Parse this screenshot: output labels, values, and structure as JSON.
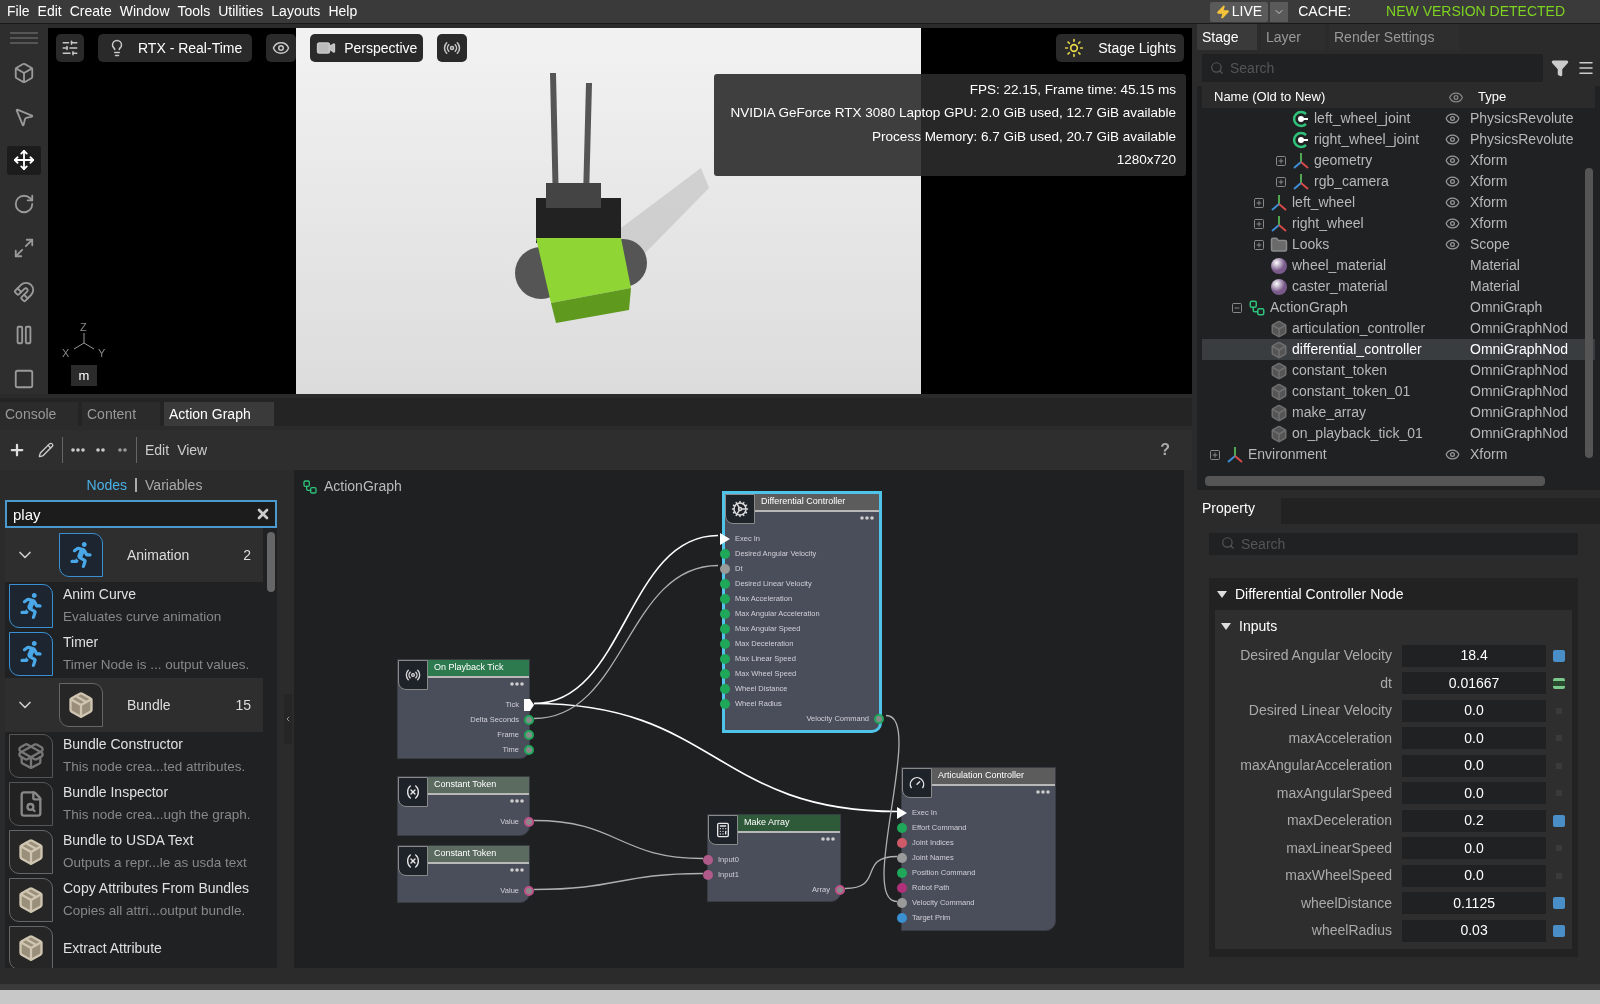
{
  "menu": [
    "File",
    "Edit",
    "Create",
    "Window",
    "Tools",
    "Utilities",
    "Layouts",
    "Help"
  ],
  "live": {
    "label": "LIVE",
    "cache_label": "CACHE:",
    "cache_status": "NEW VERSION DETECTED"
  },
  "tools": [
    {
      "kind": "select",
      "selected": false
    },
    {
      "kind": "pointer",
      "selected": false
    },
    {
      "kind": "move",
      "selected": true
    },
    {
      "kind": "rotate",
      "selected": false
    },
    {
      "kind": "scale",
      "selected": false
    },
    {
      "kind": "snap",
      "selected": false
    },
    {
      "kind": "pause",
      "selected": false
    },
    {
      "kind": "stop",
      "selected": false
    }
  ],
  "viewport": {
    "render_mode": "RTX - Real-Time",
    "camera": "Perspective",
    "lights": "Stage Lights",
    "stats": [
      "FPS: 22.15, Frame time: 45.15 ms",
      "NVIDIA GeForce RTX 3080 Laptop GPU: 2.0 GiB used, 12.7 GiB available",
      "Process Memory: 6.7 GiB used, 20.7 GiB available",
      "1280x720"
    ],
    "axes": [
      "Z",
      "X",
      "Y"
    ],
    "units": "m"
  },
  "bottom_tabs": [
    {
      "label": "Console",
      "selected": false
    },
    {
      "label": "Content",
      "selected": false
    },
    {
      "label": "Action Graph",
      "selected": true
    }
  ],
  "graph_toolbar": {
    "menus": [
      "Edit",
      "View"
    ],
    "help": "?"
  },
  "library": {
    "modes": [
      {
        "label": "Nodes",
        "selected": true
      },
      {
        "label": "Variables",
        "selected": false
      }
    ],
    "search": {
      "value": "play"
    },
    "categories": [
      {
        "name": "Animation",
        "count": "2",
        "kind": "animation",
        "expanded": true,
        "items": [
          {
            "name": "Anim Curve",
            "description": "Evaluates curve animation",
            "kind": "animation"
          },
          {
            "name": "Timer",
            "description": "Timer Node is ... output values.",
            "kind": "animation"
          }
        ]
      },
      {
        "name": "Bundle",
        "count": "15",
        "kind": "bundle",
        "expanded": true,
        "items": [
          {
            "name": "Bundle Constructor",
            "description": "This node crea...ted attributes.",
            "kind": "constructor"
          },
          {
            "name": "Bundle Inspector",
            "description": "This node crea...ugh the graph.",
            "kind": "inspector"
          },
          {
            "name": "Bundle to USDA Text",
            "description": "Outputs a repr...le as usda text",
            "kind": "bundle"
          },
          {
            "name": "Copy Attributes From Bundles",
            "description": "Copies all attri...output bundle.",
            "kind": "bundle"
          },
          {
            "name": "Extract Attribute",
            "kind": "bundle"
          }
        ]
      }
    ]
  },
  "graph": {
    "title": "ActionGraph",
    "nodes": [
      {
        "title": "Differential Controller",
        "kind": "controller",
        "color": "#5c5c5c",
        "selected": true,
        "inputs": [
          {
            "label": "Exec In",
            "kind": "exec",
            "color": "#ffffff"
          },
          {
            "label": "Desired Angular Velocity",
            "kind": "data",
            "color": "#1fa85a"
          },
          {
            "label": "Dt",
            "kind": "data",
            "color": "#9a9a9a"
          },
          {
            "label": "Desired Linear Velocity",
            "kind": "data",
            "color": "#1fa85a"
          },
          {
            "label": "Max Acceleration",
            "kind": "data",
            "color": "#1fa85a"
          },
          {
            "label": "Max Angular Acceleration",
            "kind": "data",
            "color": "#1fa85a"
          },
          {
            "label": "Max Angular Speed",
            "kind": "data",
            "color": "#1fa85a"
          },
          {
            "label": "Max Deceleration",
            "kind": "data",
            "color": "#1fa85a"
          },
          {
            "label": "Max Linear Speed",
            "kind": "data",
            "color": "#1fa85a"
          },
          {
            "label": "Max Wheel Speed",
            "kind": "data",
            "color": "#1fa85a"
          },
          {
            "label": "Wheel Distance",
            "kind": "data",
            "color": "#1fa85a"
          },
          {
            "label": "Wheel Radius",
            "kind": "data",
            "color": "#1fa85a"
          }
        ],
        "outputs": [
          {
            "label": "Velocity Command",
            "kind": "data",
            "color": "#1fa85a"
          }
        ]
      },
      {
        "title": "On Playback Tick",
        "kind": "playback",
        "color": "#2d7a4f",
        "selected": false,
        "outputs": [
          {
            "label": "Tick",
            "kind": "exec",
            "color": "#ffffff"
          },
          {
            "label": "Delta Seconds",
            "kind": "data",
            "color": "#1fa85a"
          },
          {
            "label": "Frame",
            "kind": "data",
            "color": "#1fa85a"
          },
          {
            "label": "Time",
            "kind": "data",
            "color": "#1fa85a"
          }
        ]
      },
      {
        "title": "Constant Token",
        "kind": "constant",
        "color": "#5b6b60",
        "selected": false,
        "outputs": [
          {
            "label": "Value",
            "kind": "data",
            "color": "#c0508a"
          }
        ]
      },
      {
        "title": "Constant Token",
        "kind": "constant",
        "color": "#5b6b60",
        "selected": false,
        "outputs": [
          {
            "label": "Value",
            "kind": "data",
            "color": "#c0508a"
          }
        ]
      },
      {
        "title": "Make Array",
        "kind": "math",
        "color": "#2f5a3a",
        "selected": false,
        "inputs": [
          {
            "label": "Input0",
            "kind": "data",
            "color": "#b05a8a"
          },
          {
            "label": "Input1",
            "kind": "data",
            "color": "#b05a8a"
          }
        ],
        "outputs": [
          {
            "label": "Array",
            "kind": "data",
            "color": "#c0508a"
          }
        ]
      },
      {
        "title": "Articulation Controller",
        "kind": "articulation",
        "color": "#5c5c5c",
        "selected": false,
        "inputs": [
          {
            "label": "Exec In",
            "kind": "exec",
            "color": "#ffffff"
          },
          {
            "label": "Effort Command",
            "kind": "data",
            "color": "#1fa85a"
          },
          {
            "label": "Joint Indices",
            "kind": "data",
            "color": "#d05a6a"
          },
          {
            "label": "Joint Names",
            "kind": "data",
            "color": "#9a9a9a"
          },
          {
            "label": "Position Command",
            "kind": "data",
            "color": "#1fa85a"
          },
          {
            "label": "Robot Path",
            "kind": "data",
            "color": "#b0307a"
          },
          {
            "label": "Velocity Command",
            "kind": "data",
            "color": "#9a9a9a"
          },
          {
            "label": "Target Prim",
            "kind": "data",
            "color": "#3a8fd0"
          }
        ]
      }
    ]
  },
  "stage": {
    "tabs": [
      {
        "label": "Stage",
        "selected": true
      },
      {
        "label": "Layer",
        "selected": false
      },
      {
        "label": "Render Settings",
        "selected": false
      }
    ],
    "search": {
      "placeholder": "Search"
    },
    "columns": [
      "Name (Old to New)",
      "Type"
    ],
    "tree": [
      {
        "children": [
          {
            "children": [
              {
                "children": [
                  {
                    "name": "left_wheel_joint",
                    "type": "PhysicsRevolute",
                    "kind": "joint",
                    "eye": true,
                    "selected": false
                  },
                  {
                    "name": "right_wheel_joint",
                    "type": "PhysicsRevolute",
                    "kind": "joint",
                    "eye": true,
                    "selected": false
                  },
                  {
                    "name": "geometry",
                    "type": "Xform",
                    "kind": "xform",
                    "eye": true,
                    "selected": false,
                    "expanded": false
                  },
                  {
                    "name": "rgb_camera",
                    "type": "Xform",
                    "kind": "xform",
                    "eye": true,
                    "selected": false,
                    "expanded": false
                  }
                ]
              },
              {
                "name": "left_wheel",
                "type": "Xform",
                "kind": "xform",
                "eye": true,
                "selected": false,
                "expanded": false
              },
              {
                "name": "right_wheel",
                "type": "Xform",
                "kind": "xform",
                "eye": true,
                "selected": false,
                "expanded": false
              },
              {
                "name": "Looks",
                "type": "Scope",
                "kind": "folder",
                "eye": true,
                "selected": false,
                "expanded": false
              },
              {
                "name": "wheel_material",
                "type": "Material",
                "kind": "material",
                "eye": false,
                "selected": false
              },
              {
                "name": "caster_material",
                "type": "Material",
                "kind": "material",
                "eye": false,
                "selected": false
              }
            ]
          },
          {
            "name": "ActionGraph",
            "type": "OmniGraph",
            "kind": "graph",
            "eye": false,
            "selected": false,
            "expanded": true,
            "children": [
              {
                "name": "articulation_controller",
                "type": "OmniGraphNod",
                "kind": "node",
                "eye": false,
                "selected": false
              },
              {
                "name": "differential_controller",
                "type": "OmniGraphNod",
                "kind": "node",
                "eye": false,
                "selected": true
              },
              {
                "name": "constant_token",
                "type": "OmniGraphNod",
                "kind": "node",
                "eye": false,
                "selected": false
              },
              {
                "name": "constant_token_01",
                "type": "OmniGraphNod",
                "kind": "node",
                "eye": false,
                "selected": false
              },
              {
                "name": "make_array",
                "type": "OmniGraphNod",
                "kind": "node",
                "eye": false,
                "selected": false
              },
              {
                "name": "on_playback_tick_01",
                "type": "OmniGraphNod",
                "kind": "node",
                "eye": false,
                "selected": false
              }
            ]
          }
        ]
      },
      {
        "name": "Environment",
        "type": "Xform",
        "kind": "xform",
        "eye": true,
        "selected": false,
        "expanded": false
      }
    ]
  },
  "property": {
    "tab": "Property",
    "search": {
      "placeholder": "Search"
    },
    "section": {
      "title": "Differential Controller Node",
      "expanded": true
    },
    "group": {
      "title": "Inputs",
      "expanded": true
    },
    "rows": [
      {
        "label": "Desired Angular Velocity",
        "value": "18.4",
        "kind": "authored"
      },
      {
        "label": "dt",
        "value": "0.01667",
        "kind": "connected"
      },
      {
        "label": "Desired Linear Velocity",
        "value": "0.0",
        "kind": "default"
      },
      {
        "label": "maxAcceleration",
        "value": "0.0",
        "kind": "default"
      },
      {
        "label": "maxAngularAcceleration",
        "value": "0.0",
        "kind": "default"
      },
      {
        "label": "maxAngularSpeed",
        "value": "0.0",
        "kind": "default"
      },
      {
        "label": "maxDeceleration",
        "value": "0.2",
        "kind": "authored"
      },
      {
        "label": "maxLinearSpeed",
        "value": "0.0",
        "kind": "default"
      },
      {
        "label": "maxWheelSpeed",
        "value": "0.0",
        "kind": "default"
      },
      {
        "label": "wheelDistance",
        "value": "0.1125",
        "kind": "authored"
      },
      {
        "label": "wheelRadius",
        "value": "0.03",
        "kind": "authored"
      }
    ]
  }
}
